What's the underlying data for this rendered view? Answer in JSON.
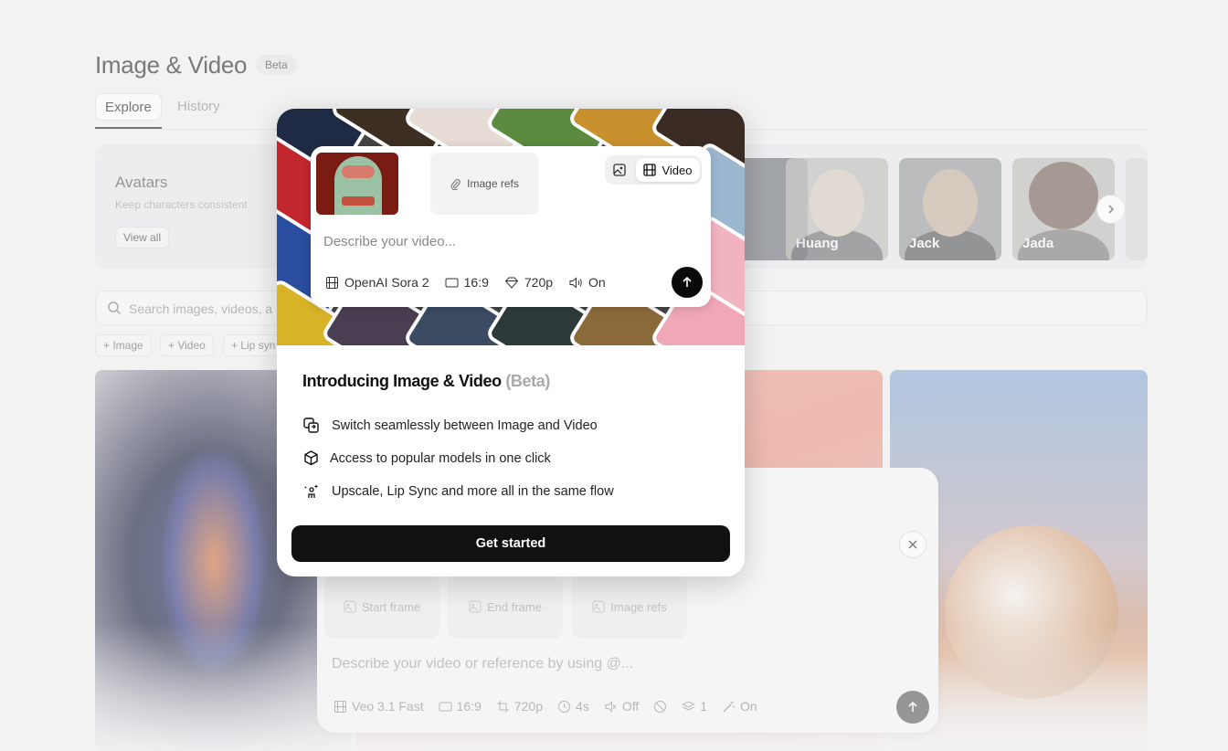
{
  "page": {
    "title": "Image & Video",
    "badge": "Beta",
    "tabs": [
      {
        "label": "Explore"
      },
      {
        "label": "History"
      }
    ]
  },
  "avatars": {
    "title": "Avatars",
    "subtitle": "Keep characters consistent",
    "view_all": "View all",
    "items": [
      {
        "name": "Huang"
      },
      {
        "name": "Jack"
      },
      {
        "name": "Jada"
      }
    ]
  },
  "search": {
    "placeholder": "Search images, videos, a",
    "chips": [
      {
        "label": "Image"
      },
      {
        "label": "Video"
      },
      {
        "label": "Lip syn"
      }
    ]
  },
  "composer": {
    "frames": [
      {
        "label": "Start frame"
      },
      {
        "label": "End frame"
      },
      {
        "label": "Image refs"
      }
    ],
    "placeholder": "Describe your video or reference by using @...",
    "toolbar": {
      "model": "Veo 3.1 Fast",
      "ratio": "16:9",
      "resolution": "720p",
      "duration": "4s",
      "audio": "Off",
      "count": "1",
      "enhance": "On"
    }
  },
  "modal": {
    "prompt_card": {
      "image_refs": "Image refs",
      "mode_active": "Video",
      "placeholder": "Describe your video...",
      "model": "OpenAI Sora 2",
      "ratio": "16:9",
      "resolution": "720p",
      "audio": "On"
    },
    "heading": "Introducing Image & Video",
    "heading_beta": "(Beta)",
    "features": [
      {
        "icon": "switch-icon",
        "text": "Switch seamlessly between Image and Video"
      },
      {
        "icon": "cube-icon",
        "text": "Access to popular models in one click"
      },
      {
        "icon": "sparkle-person-icon",
        "text": "Upscale, Lip Sync and more all in the same flow"
      }
    ],
    "cta": "Get started"
  }
}
